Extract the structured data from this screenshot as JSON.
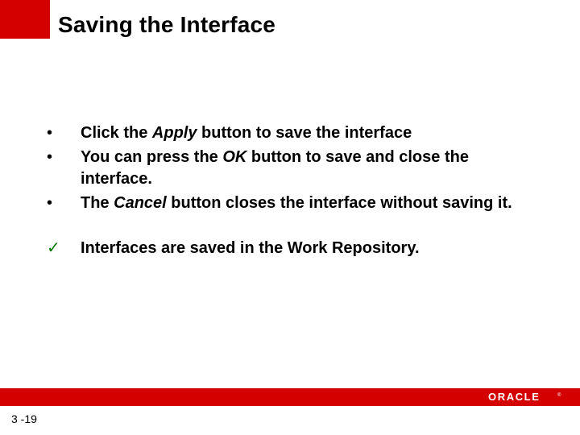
{
  "title": "Saving the Interface",
  "bullets": [
    {
      "marker": "•",
      "pre": "Click the ",
      "em": "Apply",
      "post": " button to save the interface"
    },
    {
      "marker": "•",
      "pre": "You can press the ",
      "em": "OK",
      "post": " button to save and close the interface."
    },
    {
      "marker": "•",
      "pre": "The ",
      "em": "Cancel",
      "post": " button closes the interface without saving it."
    }
  ],
  "check": {
    "marker": "✓",
    "text": "Interfaces are saved in the Work Repository."
  },
  "page_number": "3 -19",
  "logo_text": "ORACLE"
}
